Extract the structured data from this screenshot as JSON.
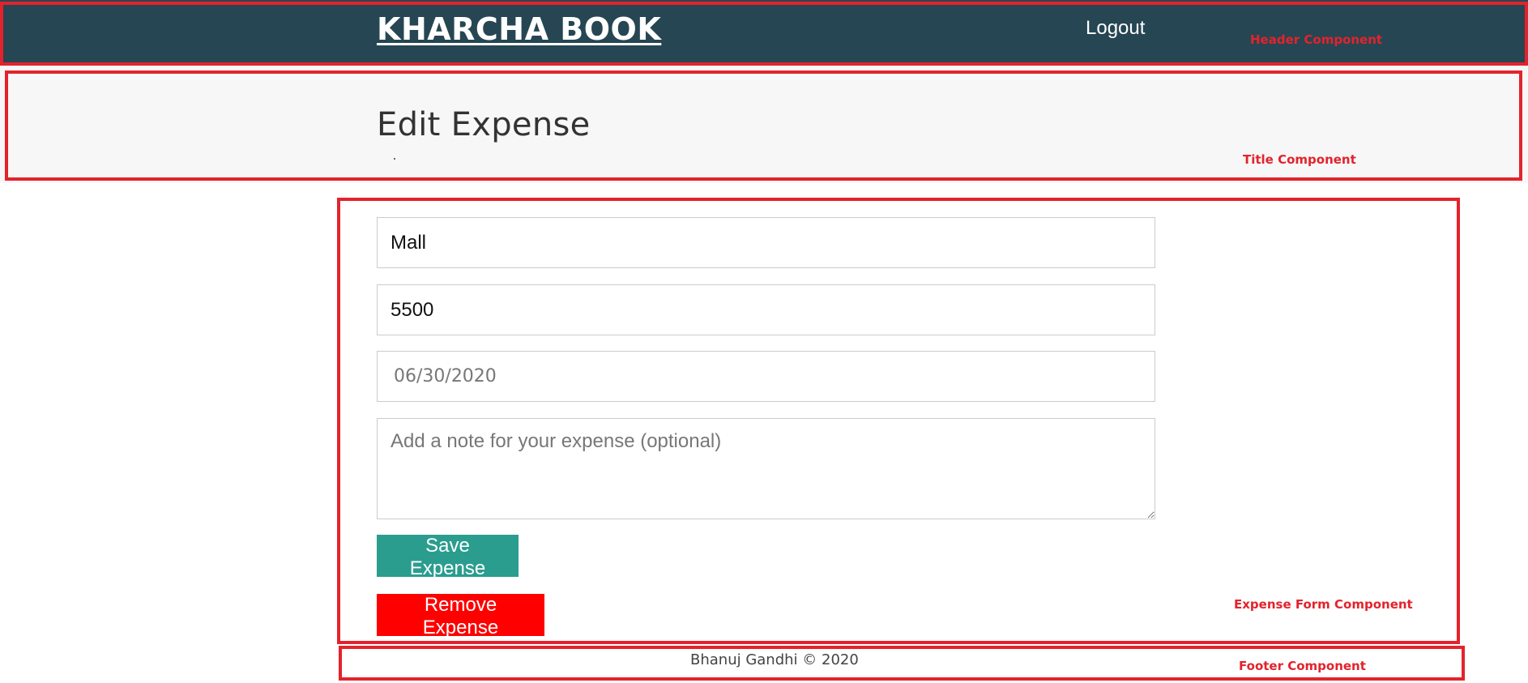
{
  "header": {
    "brand": "KHARCHA BOOK",
    "logout_label": "Logout"
  },
  "title": {
    "text": "Edit Expense"
  },
  "form": {
    "description_value": "Mall",
    "amount_value": "5500",
    "date_value": "06/30/2020",
    "note_placeholder": "Add a note for your expense (optional)",
    "save_label": "Save Expense",
    "remove_label": "Remove Expense"
  },
  "footer": {
    "text": "Bhanuj Gandhi © 2020"
  },
  "annotations": {
    "header": "Header Component",
    "title": "Title Component",
    "form": "Expense Form Component",
    "footer": "Footer Component"
  },
  "colors": {
    "header_bg": "#264653",
    "save_button": "#2a9d8f",
    "remove_button": "#ff0000",
    "annotation": "#e3232c"
  }
}
